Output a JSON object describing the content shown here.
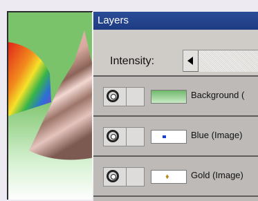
{
  "panel": {
    "title": "Layers",
    "intensity_label": "Intensity:"
  },
  "layers": [
    {
      "name": "Background (",
      "thumb": "green-gradient"
    },
    {
      "name": "Blue (Image)",
      "thumb": "blue-dot"
    },
    {
      "name": "Gold (Image)",
      "thumb": "gold-glyph"
    }
  ],
  "icons": {
    "visibility": "eye-icon",
    "slider_left": "arrow-left-icon"
  }
}
